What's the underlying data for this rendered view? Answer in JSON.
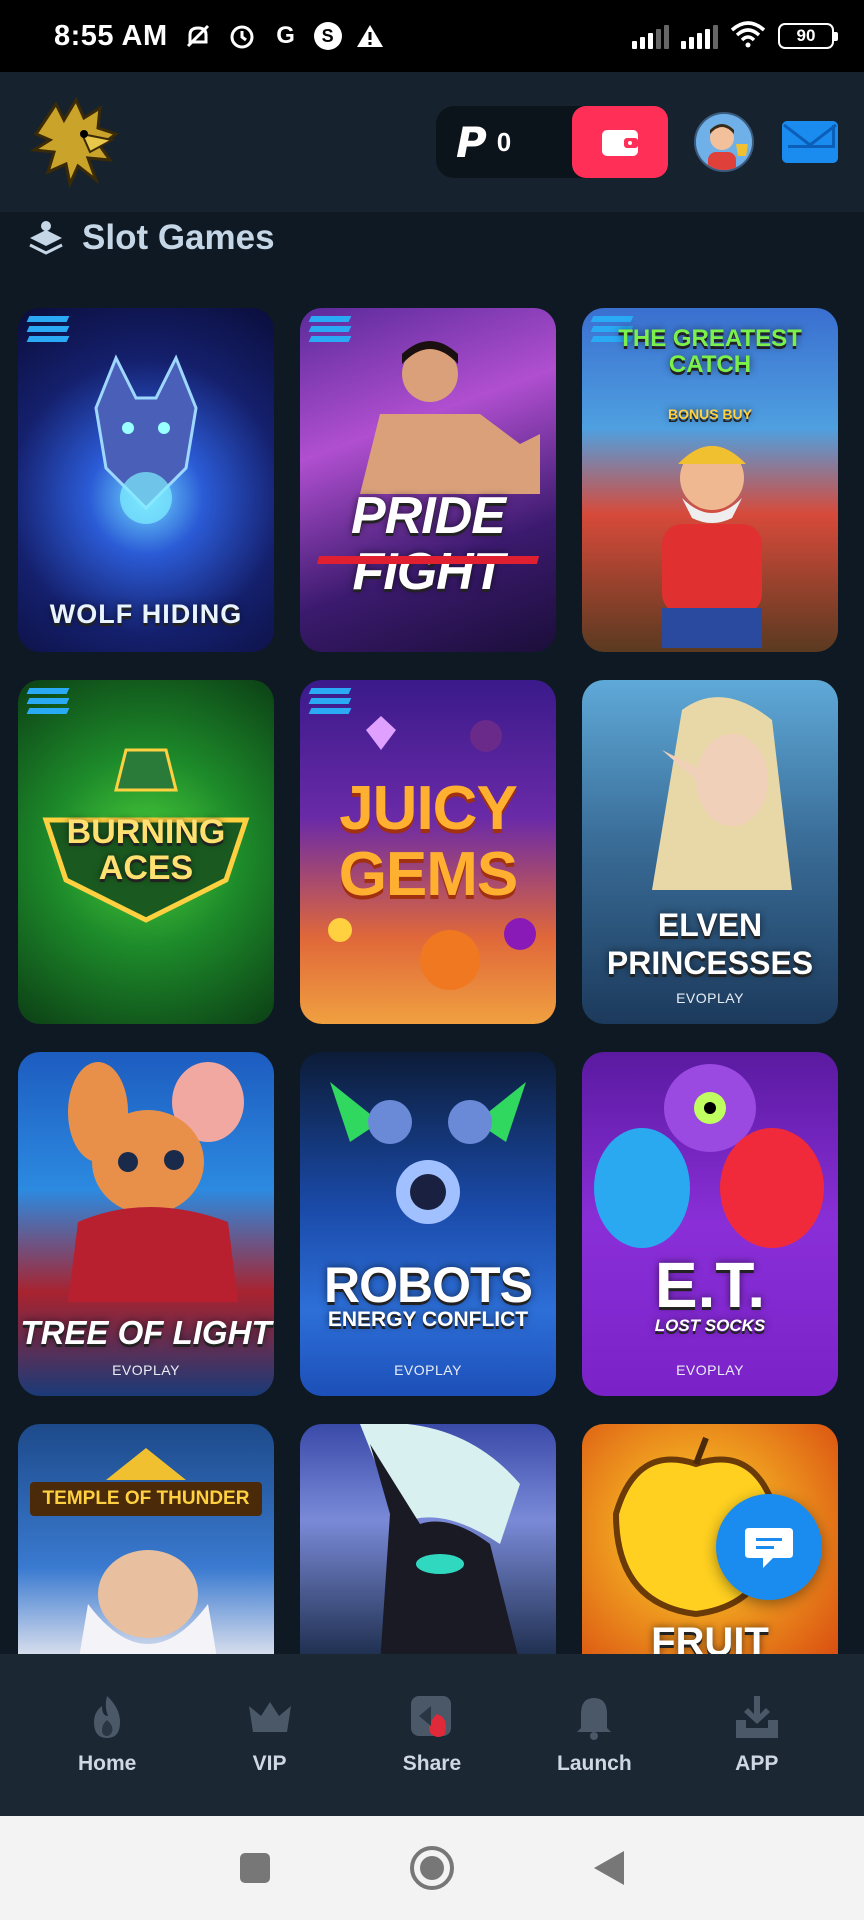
{
  "status_bar": {
    "time": "8:55 AM",
    "icons": [
      "mute-alarm-icon",
      "alarm-icon",
      "google-icon",
      "shazam-icon",
      "warning-icon"
    ],
    "battery": "90"
  },
  "header": {
    "logo": "eagle-logo",
    "currency_symbol": "P",
    "balance": "0",
    "wallet_icon": "wallet-icon",
    "avatar_icon": "user-avatar",
    "mail_icon": "mail-icon"
  },
  "section": {
    "title": "Slot Games",
    "icon": "stack-icon"
  },
  "games": [
    {
      "title": "WOLF HIDING",
      "provider": ""
    },
    {
      "title": "PRIDE FIGHT",
      "provider": ""
    },
    {
      "title": "THE GREATEST CATCH",
      "subtitle": "BONUS BUY",
      "provider": ""
    },
    {
      "title": "BURNING ACES",
      "provider": ""
    },
    {
      "title": "JUICY GEMS",
      "provider": ""
    },
    {
      "title": "ELVEN PRINCESSES",
      "provider": "EVOPLAY"
    },
    {
      "title": "TREE OF LIGHT",
      "provider": "EVOPLAY"
    },
    {
      "title": "ROBOTS",
      "subtitle": "ENERGY CONFLICT",
      "provider": "EVOPLAY"
    },
    {
      "title": "E.T.",
      "subtitle": "LOST SOCKS",
      "provider": "EVOPLAY"
    },
    {
      "title": "TEMPLE OF THUNDER",
      "provider": ""
    },
    {
      "title": "",
      "provider": ""
    },
    {
      "title": "FRUIT",
      "provider": ""
    }
  ],
  "bottom_nav": [
    {
      "label": "Home",
      "icon": "flame-icon"
    },
    {
      "label": "VIP",
      "icon": "crown-icon"
    },
    {
      "label": "Share",
      "icon": "share-icon"
    },
    {
      "label": "Launch",
      "icon": "bell-icon"
    },
    {
      "label": "APP",
      "icon": "download-icon"
    }
  ],
  "colors": {
    "background": "#0f1923",
    "header": "#16222e",
    "accent_red": "#ff2f57",
    "accent_blue": "#1a8cf0",
    "nav_bg": "#1b2733"
  }
}
